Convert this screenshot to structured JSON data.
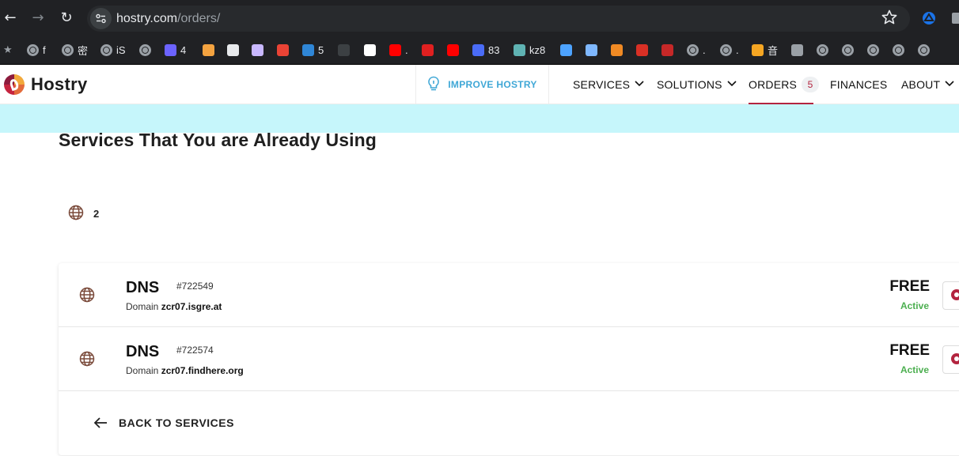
{
  "browser": {
    "url_host": "hostry.com",
    "url_path": "/orders/",
    "bookmarks": [
      {
        "icon": "globe-favicon",
        "label": "f"
      },
      {
        "icon": "globe-favicon",
        "label": "密"
      },
      {
        "icon": "globe-favicon",
        "label": "iS"
      },
      {
        "icon": "globe-favicon",
        "label": ""
      },
      {
        "icon": "bot-favicon",
        "label": "4"
      },
      {
        "icon": "orange-dot-favicon",
        "label": ""
      },
      {
        "icon": "dark-square-favicon",
        "label": ""
      },
      {
        "icon": "face-favicon",
        "label": ""
      },
      {
        "icon": "gmail-favicon",
        "label": ""
      },
      {
        "icon": "onedrive-favicon",
        "label": "5"
      },
      {
        "icon": "github-favicon",
        "label": ""
      },
      {
        "icon": "google-favicon",
        "label": ""
      },
      {
        "icon": "youtube-favicon",
        "label": "."
      },
      {
        "icon": "red-glyph-favicon",
        "label": ""
      },
      {
        "icon": "youtube-favicon",
        "label": ""
      },
      {
        "icon": "blue-q-favicon",
        "label": "83"
      },
      {
        "icon": "triangle-favicon",
        "label": "kz8"
      },
      {
        "icon": "knot-favicon",
        "label": ""
      },
      {
        "icon": "cloud-favicon",
        "label": ""
      },
      {
        "icon": "orange-ball-favicon",
        "label": ""
      },
      {
        "icon": "red-square-favicon",
        "label": ""
      },
      {
        "icon": "seal-favicon",
        "label": ""
      },
      {
        "icon": "globe-favicon",
        "label": "."
      },
      {
        "icon": "globe-favicon",
        "label": "."
      },
      {
        "icon": "st-favicon",
        "label": "音"
      },
      {
        "icon": "gear-favicon",
        "label": ""
      },
      {
        "icon": "globe-favicon",
        "label": ""
      },
      {
        "icon": "globe-favicon",
        "label": ""
      },
      {
        "icon": "globe-favicon",
        "label": ""
      },
      {
        "icon": "globe-favicon",
        "label": ""
      },
      {
        "icon": "globe-favicon",
        "label": ""
      }
    ]
  },
  "site": {
    "logo_text": "Hostry",
    "improve_label": "IMPROVE HOSTRY",
    "menu": {
      "services": "SERVICES",
      "solutions": "SOLUTIONS",
      "orders": "ORDERS",
      "orders_count": "5",
      "finances": "FINANCES",
      "about": "ABOUT"
    }
  },
  "page": {
    "title": "Services That You are Already Using",
    "domain_count": "2",
    "services": [
      {
        "name": "DNS",
        "id": "#722549",
        "domain_label": "Domain",
        "domain": "zcr07.isgre.at",
        "price": "FREE",
        "status": "Active"
      },
      {
        "name": "DNS",
        "id": "#722574",
        "domain_label": "Domain",
        "domain": "zcr07.findhere.org",
        "price": "FREE",
        "status": "Active"
      }
    ],
    "back_label": "BACK TO SERVICES"
  },
  "colors": {
    "brand": "#b3243f",
    "info_blue": "#3fa7d6",
    "notice_band": "#c6f6fb",
    "status_active": "#4caf50",
    "icon_brown": "#7a4a3a"
  }
}
